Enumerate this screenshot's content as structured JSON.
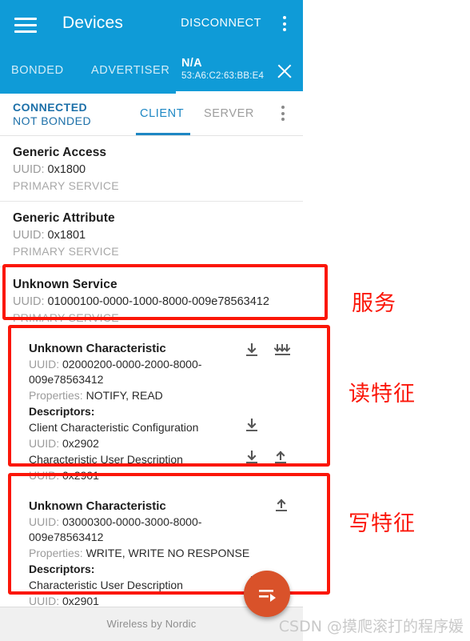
{
  "toolbar": {
    "title": "Devices",
    "disconnect_label": "DISCONNECT",
    "menu_icon": "kebab-menu-icon",
    "nav_icon": "hamburger-menu-icon"
  },
  "tabs": {
    "bonded": "BONDED",
    "advertiser": "ADVERTISER",
    "device_name": "N/A",
    "device_mac": "53:A6:C2:63:BB:E4",
    "close_icon": "close-icon"
  },
  "connection": {
    "state_line1": "CONNECTED",
    "state_line2": "NOT BONDED",
    "client_tab": "CLIENT",
    "server_tab": "SERVER",
    "menu_icon": "kebab-menu-icon"
  },
  "labels": {
    "uuid_prefix": "UUID:",
    "properties_prefix": "Properties:",
    "descriptors_heading": "Descriptors:"
  },
  "services": [
    {
      "name": "Generic Access",
      "uuid": "0x1800",
      "type": "PRIMARY SERVICE"
    },
    {
      "name": "Generic Attribute",
      "uuid": "0x1801",
      "type": "PRIMARY SERVICE"
    },
    {
      "name": "Unknown Service",
      "uuid": "01000100-0000-1000-8000-009e78563412",
      "type": "PRIMARY SERVICE"
    }
  ],
  "characteristics": [
    {
      "name": "Unknown Characteristic",
      "uuid": "02000200-0000-2000-8000-009e78563412",
      "properties": "NOTIFY, READ",
      "actions": [
        "read-download-icon",
        "notify-multi-arrow-icon"
      ],
      "descriptors": [
        {
          "name": "Client Characteristic Configuration",
          "uuid": "0x2902",
          "actions": [
            "read-download-icon"
          ]
        },
        {
          "name": "Characteristic User Description",
          "uuid": "0x2901",
          "actions": [
            "read-download-icon",
            "write-upload-icon"
          ]
        }
      ]
    },
    {
      "name": "Unknown Characteristic",
      "uuid": "03000300-0000-3000-8000-009e78563412",
      "properties": "WRITE, WRITE NO RESPONSE",
      "actions": [
        "write-upload-icon"
      ],
      "descriptors": [
        {
          "name": "Characteristic User Description",
          "uuid": "0x2901",
          "actions": [
            "read-download-icon",
            "write-upload-icon"
          ]
        }
      ]
    }
  ],
  "annotations": [
    {
      "text": "服务"
    },
    {
      "text": "读特征"
    },
    {
      "text": "写特征"
    }
  ],
  "fab": {
    "icon": "send-arrow-icon"
  },
  "footer": {
    "text": "Wireless by Nordic"
  },
  "watermark": {
    "text": "CSDN @摸爬滚打的程序媛"
  },
  "colors": {
    "primary_blue": "#0f9bd7",
    "accent_blue": "#1d87c4",
    "annotation_red": "#fb1608",
    "fab_orange": "#d9522a"
  }
}
